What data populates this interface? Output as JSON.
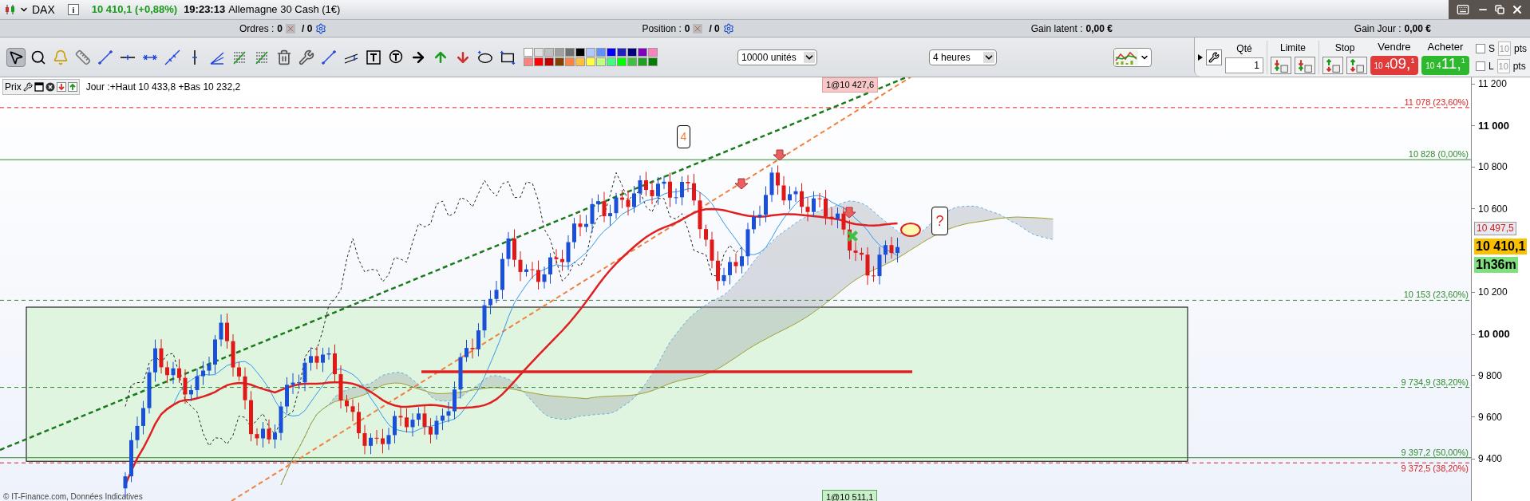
{
  "header": {
    "symbol": "DAX",
    "info": "i",
    "change": "10 410,1 (+0,88%)",
    "time": "19:23:13",
    "instrument": "Allemagne 30 Cash (1€)"
  },
  "summary": [
    {
      "label": "Ordres :",
      "value": "0",
      "total": "/ 0",
      "kind": "orders"
    },
    {
      "label": "Position :",
      "value": "0",
      "total": "/ 0",
      "kind": "orders"
    },
    {
      "label": "Gain latent :",
      "value": "0,00 €",
      "kind": "gain"
    },
    {
      "label": "Gain Jour :",
      "value": "0,00 €",
      "kind": "gain"
    }
  ],
  "tools": [
    {
      "kind": "pointer",
      "selected": true
    },
    {
      "kind": "zoom",
      "selected": false
    },
    {
      "kind": "alert",
      "selected": false
    },
    {
      "kind": "ruler",
      "selected": false
    },
    {
      "kind": "segment",
      "selected": false
    },
    {
      "kind": "hline",
      "selected": false
    },
    {
      "kind": "hsegment",
      "selected": false
    },
    {
      "kind": "line",
      "selected": false
    },
    {
      "kind": "vline",
      "selected": false
    },
    {
      "kind": "fan",
      "selected": false
    },
    {
      "kind": "fibo",
      "selected": false
    },
    {
      "kind": "fibo",
      "selected": false
    },
    {
      "kind": "trash",
      "selected": false
    },
    {
      "kind": "tools",
      "selected": false
    },
    {
      "kind": "segment",
      "selected": false
    },
    {
      "kind": "channel",
      "selected": false
    },
    {
      "kind": "text",
      "selected": false
    },
    {
      "kind": "bubble",
      "selected": false
    },
    {
      "kind": "arrow-right",
      "selected": false
    },
    {
      "kind": "arrow-up",
      "selected": false
    },
    {
      "kind": "arrow-down",
      "selected": false
    },
    {
      "kind": "ellipse",
      "selected": false
    },
    {
      "kind": "rectangle",
      "selected": false
    }
  ],
  "palette": [
    {
      "color": "#ffffff"
    },
    {
      "color": "#e0e0e0"
    },
    {
      "color": "#c0c0c0"
    },
    {
      "color": "#a0a0a0"
    },
    {
      "color": "#707070"
    },
    {
      "color": "#000000"
    },
    {
      "color": "#b0c8ff"
    },
    {
      "color": "#6090ff"
    },
    {
      "color": "#0000ff"
    },
    {
      "color": "#2020c0"
    },
    {
      "color": "#000080"
    },
    {
      "color": "#8000c0"
    },
    {
      "color": "#ff80c0"
    },
    {
      "color": "#ff8080"
    },
    {
      "color": "#ff0000"
    },
    {
      "color": "#c00000"
    },
    {
      "color": "#804000"
    },
    {
      "color": "#ff8040"
    },
    {
      "color": "#ffc040"
    },
    {
      "color": "#ffff40"
    },
    {
      "color": "#c0ff80"
    },
    {
      "color": "#40ff80"
    },
    {
      "color": "#00ff00"
    },
    {
      "color": "#40c040"
    },
    {
      "color": "#20a020"
    },
    {
      "color": "#008000"
    }
  ],
  "units_dropdown": "10000 unités",
  "period_dropdown": "4 heures",
  "trade": {
    "qty_label": "Qté",
    "qty": "1",
    "limit_label": "Limite",
    "stop_label": "Stop",
    "sell": {
      "label": "Vendre",
      "small": "10 4",
      "big": "09,",
      "tail": "1"
    },
    "buy": {
      "label": "Acheter",
      "small": "10 4",
      "big": "11,",
      "tail": "1"
    },
    "protections": [
      {
        "letter": "S",
        "checked": false,
        "placeholder": "10",
        "unit": "pts"
      },
      {
        "letter": "L",
        "checked": false,
        "placeholder": "10",
        "unit": "pts"
      }
    ]
  },
  "chart": {
    "label": "Prix",
    "day_info": "Jour :+Haut 10 433,8 +Bas 10 232,2",
    "ticks": [
      {
        "label": "11 200",
        "major": false
      },
      {
        "label": "11 000",
        "major": true
      },
      {
        "label": "10 800",
        "major": false
      },
      {
        "label": "10 600",
        "major": false
      },
      {
        "label": "10 200",
        "major": false
      },
      {
        "label": "10 000",
        "major": true
      },
      {
        "label": "9 800",
        "major": false
      },
      {
        "label": "9 600",
        "major": false
      },
      {
        "label": "9 400",
        "major": false
      }
    ],
    "fib_levels": [
      {
        "label": "11 078 (23,60%)",
        "color": "#dd2222",
        "kind": "dashed"
      },
      {
        "label": "10 828 (0,00%)",
        "color": "#2e8b2e",
        "kind": "solid"
      },
      {
        "label": "10 153 (23,60%)",
        "color": "#2e8b2e",
        "kind": "dashed"
      },
      {
        "label": "9 734,9 (38,20%)",
        "color": "#2e8b2e",
        "kind": "dashed"
      },
      {
        "label": "9 397,2 (50,00%)",
        "color": "#2e8b2e",
        "kind": "solid"
      },
      {
        "label": "9 372,5 (38,20%)",
        "color": "#dd2222",
        "kind": "dashed"
      }
    ],
    "price_tags": [
      {
        "label": "10 497,5",
        "kind": "level"
      },
      {
        "label": "10 410,1",
        "kind": "last"
      },
      {
        "label": "1h36m",
        "kind": "timer"
      }
    ],
    "order_tags": [
      {
        "label": "1@10 427,6",
        "kind": "sell"
      },
      {
        "label": "1@10 511,1",
        "kind": "buy"
      }
    ],
    "notes": [
      "4",
      "?"
    ],
    "copyright": "© IT-Finance.com, Données Indicatives"
  }
}
